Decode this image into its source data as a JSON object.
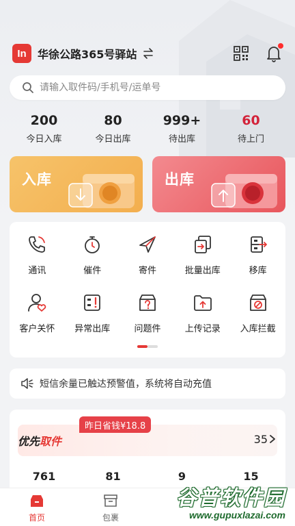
{
  "header": {
    "logo_text": "In",
    "station_name": "华徐公路365号驿站"
  },
  "search": {
    "placeholder": "请输入取件码/手机号/运单号"
  },
  "stats": [
    {
      "value": "200",
      "label": "今日入库"
    },
    {
      "value": "80",
      "label": "今日出库"
    },
    {
      "value": "999+",
      "label": "待出库"
    },
    {
      "value": "60",
      "label": "待上门",
      "color": "#d3233a"
    }
  ],
  "actions": {
    "in_label": "入库",
    "out_label": "出库"
  },
  "grid": [
    {
      "label": "通讯",
      "icon": "phone-icon"
    },
    {
      "label": "催件",
      "icon": "stopwatch-icon"
    },
    {
      "label": "寄件",
      "icon": "send-icon"
    },
    {
      "label": "批量出库",
      "icon": "batch-out-icon"
    },
    {
      "label": "移库",
      "icon": "move-stock-icon"
    },
    {
      "label": "客户关怀",
      "icon": "customer-care-icon"
    },
    {
      "label": "异常出库",
      "icon": "abnormal-out-icon"
    },
    {
      "label": "问题件",
      "icon": "problem-package-icon"
    },
    {
      "label": "上传记录",
      "icon": "upload-folder-icon"
    },
    {
      "label": "入库拦截",
      "icon": "intercept-icon"
    }
  ],
  "notice": {
    "text": "短信余量已触达预警值，系统将自动充值"
  },
  "priority": {
    "badge": "昨日省钱¥18.8",
    "title_prefix": "优先",
    "title_suffix": "取件",
    "count": "35",
    "stats": [
      "761",
      "81",
      "9",
      "15"
    ]
  },
  "tabbar": [
    {
      "label": "首页",
      "active": true
    },
    {
      "label": "包裹",
      "active": false
    }
  ],
  "watermark": {
    "title": "谷普软件园",
    "url": "www.gupuxlazai.com"
  },
  "colors": {
    "accent": "#e53935",
    "in_card": "#f3ae4e",
    "out_card": "#e8565c"
  }
}
